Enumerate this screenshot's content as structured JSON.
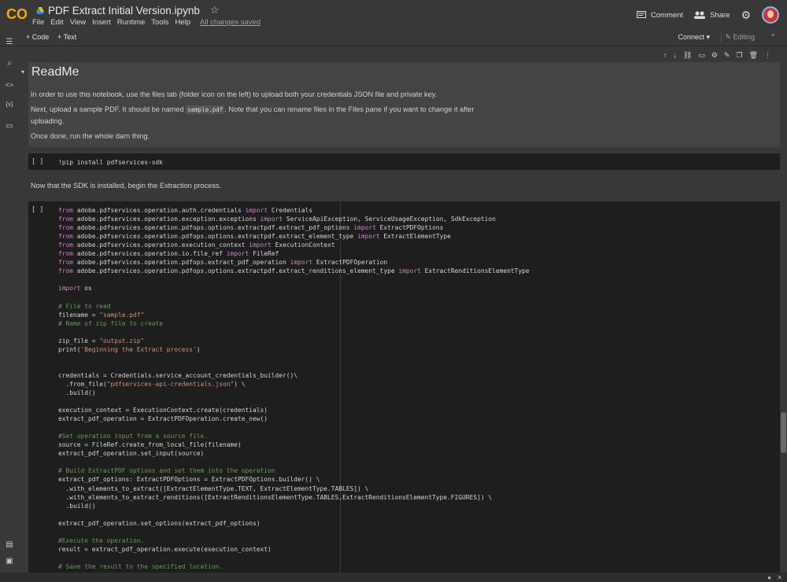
{
  "header": {
    "file_title": "PDF Extract Initial Version.ipynb",
    "menu": [
      "File",
      "Edit",
      "View",
      "Insert",
      "Runtime",
      "Tools",
      "Help"
    ],
    "saved_status": "All changes saved",
    "comment_label": "Comment",
    "share_label": "Share"
  },
  "toolbar": {
    "add_code": "+ Code",
    "add_text": "+ Text",
    "connect": "Connect ▾",
    "editing": "Editing"
  },
  "markdown_cell": {
    "title": "ReadMe",
    "p1": "In order to use this notebook, use the files tab (folder icon on the left) to upload both your credentials JSON file and private key.",
    "p2_before": "Next, upload a sample PDF. It should be named ",
    "p2_code": "sample.pdf",
    "p2_after": ". Note that you can rename files in the Files pane if you want to change it after",
    "p2_line2": "uploading.",
    "p3": "Once done, run the whole darn thing."
  },
  "code_cell_1": {
    "run_marker": "[ ]",
    "code": "!pip install pdfservices-sdk"
  },
  "text_between": "Now that the SDK is installed, begin the Extraction process.",
  "code_cell_2": {
    "run_marker": "[ ]"
  },
  "colors": {
    "background": "#383838",
    "cell_bg": "#1e1e1e",
    "markdown_bg": "#444444",
    "keyword": "#c586c0",
    "string": "#ce9178",
    "comment": "#6a9955"
  }
}
